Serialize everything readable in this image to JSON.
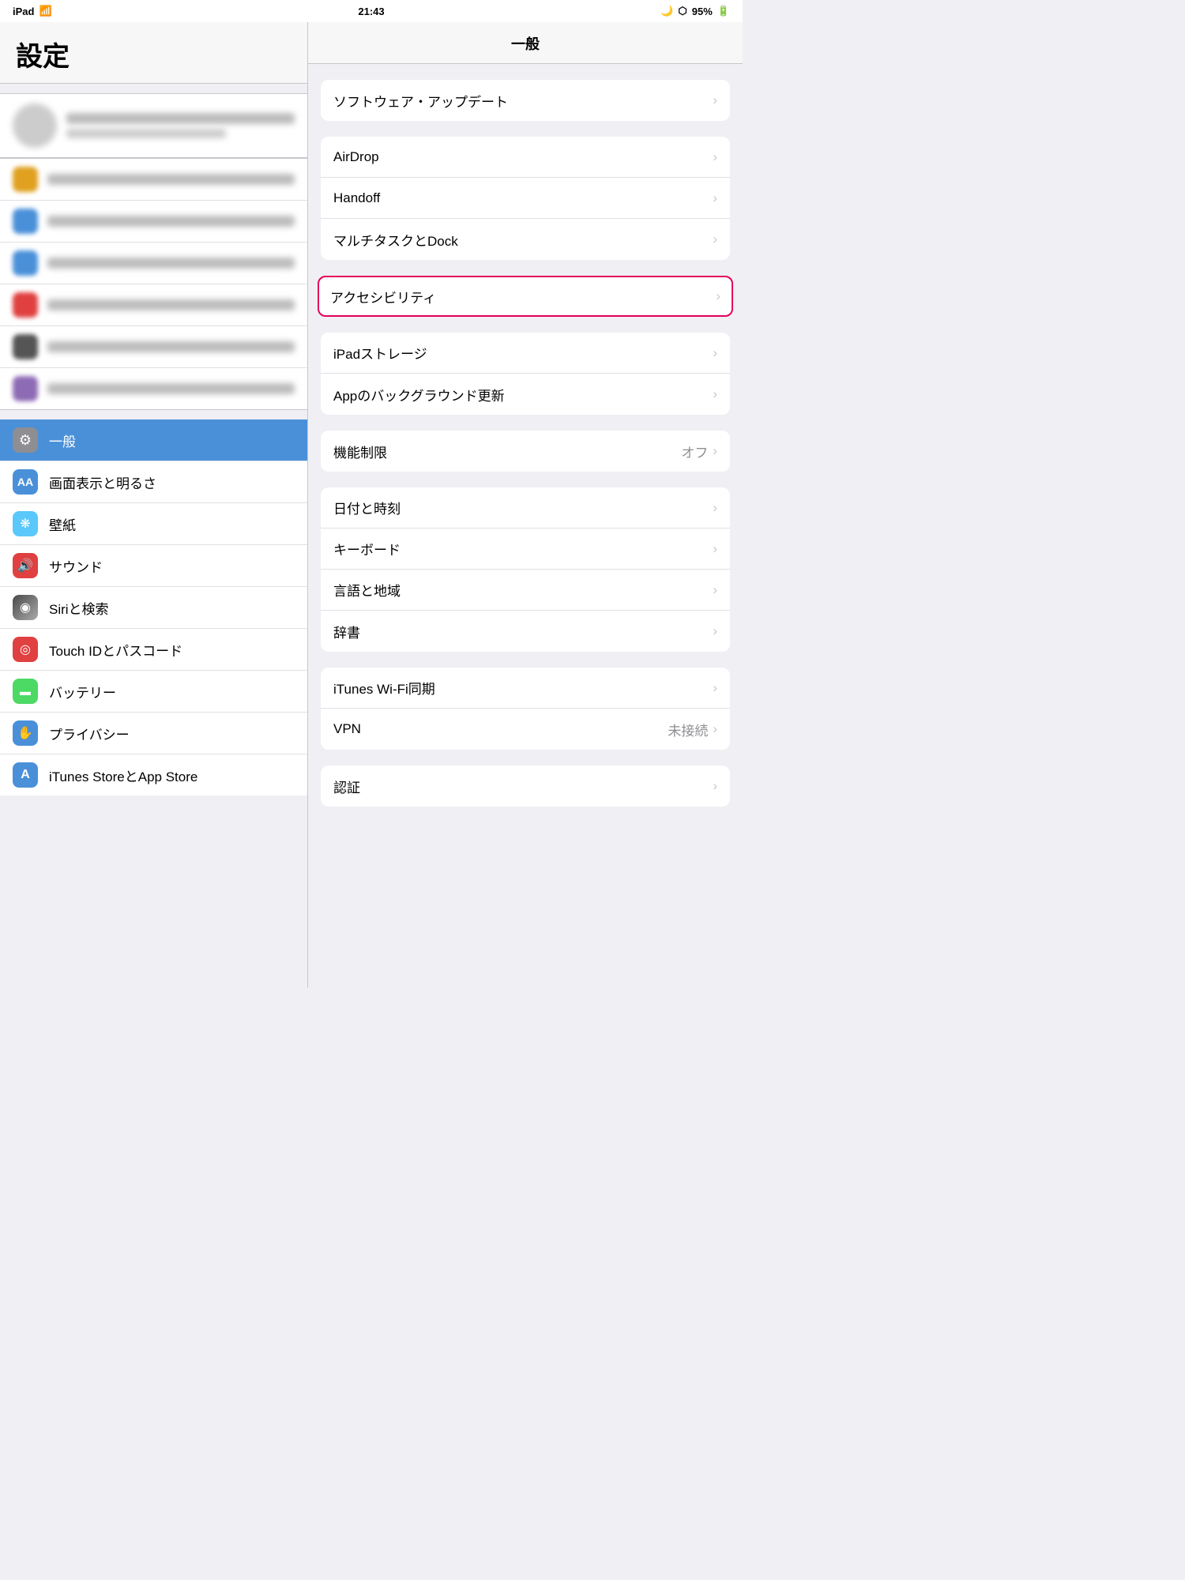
{
  "statusBar": {
    "left": "iPad",
    "wifi": "wifi",
    "time": "21:43",
    "moon": "🌙",
    "bluetooth": "bluetooth",
    "battery": "95%"
  },
  "sidebar": {
    "title": "設定",
    "activeItem": {
      "label": "一般",
      "iconColor": "#8e8e93",
      "iconGlyph": "⚙"
    },
    "menuItems": [
      {
        "label": "画面表示と明るさ",
        "iconColor": "#4a90d9",
        "iconGlyph": "AA"
      },
      {
        "label": "壁紙",
        "iconColor": "#5ac8fa",
        "iconGlyph": "❋"
      },
      {
        "label": "サウンド",
        "iconColor": "#e04040",
        "iconGlyph": "🔊"
      },
      {
        "label": "Siriと検索",
        "iconColor": "#555",
        "iconGlyph": "◉"
      },
      {
        "label": "Touch IDとパスコード",
        "iconColor": "#e04040",
        "iconGlyph": "◎"
      },
      {
        "label": "バッテリー",
        "iconColor": "#4cd964",
        "iconGlyph": "▬"
      },
      {
        "label": "プライバシー",
        "iconColor": "#4a90d9",
        "iconGlyph": "✋"
      },
      {
        "label": "iTunes StoreとApp Store",
        "iconColor": "#4a90d9",
        "iconGlyph": "A"
      }
    ]
  },
  "mainContent": {
    "title": "一般",
    "groups": [
      {
        "rows": [
          {
            "label": "ソフトウェア・アップデート",
            "value": "",
            "hasChevron": true
          }
        ]
      },
      {
        "rows": [
          {
            "label": "AirDrop",
            "value": "",
            "hasChevron": true
          },
          {
            "label": "Handoff",
            "value": "",
            "hasChevron": true
          },
          {
            "label": "マルチタスクとDock",
            "value": "",
            "hasChevron": true
          }
        ]
      },
      {
        "highlighted": true,
        "rows": [
          {
            "label": "アクセシビリティ",
            "value": "",
            "hasChevron": true
          }
        ]
      },
      {
        "rows": [
          {
            "label": "iPadストレージ",
            "value": "",
            "hasChevron": true
          },
          {
            "label": "Appのバックグラウンド更新",
            "value": "",
            "hasChevron": true
          }
        ]
      },
      {
        "rows": [
          {
            "label": "機能制限",
            "value": "オフ",
            "hasChevron": true
          }
        ]
      },
      {
        "rows": [
          {
            "label": "日付と時刻",
            "value": "",
            "hasChevron": true
          },
          {
            "label": "キーボード",
            "value": "",
            "hasChevron": true
          },
          {
            "label": "言語と地域",
            "value": "",
            "hasChevron": true
          },
          {
            "label": "辞書",
            "value": "",
            "hasChevron": true
          }
        ]
      },
      {
        "rows": [
          {
            "label": "iTunes Wi-Fi同期",
            "value": "",
            "hasChevron": true
          },
          {
            "label": "VPN",
            "value": "未接続",
            "hasChevron": true
          }
        ]
      },
      {
        "rows": [
          {
            "label": "認証",
            "value": "",
            "hasChevron": true
          }
        ]
      }
    ]
  },
  "blurredItems": [
    {
      "color": "#e0a020"
    },
    {
      "color": "#4a90d9"
    },
    {
      "color": "#4a90d9"
    },
    {
      "color": "#e04040"
    },
    {
      "color": "#555"
    },
    {
      "color": "#8e6bb5"
    }
  ]
}
